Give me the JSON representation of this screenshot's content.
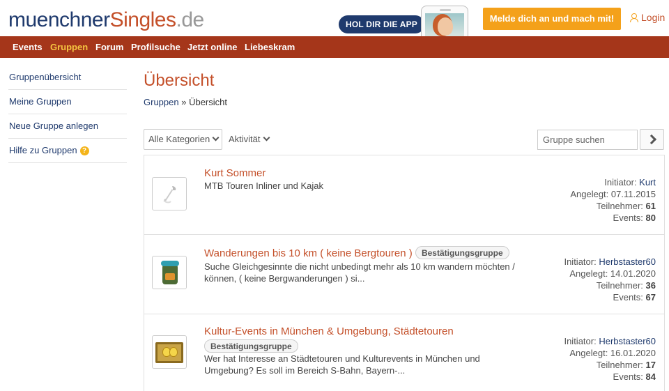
{
  "header": {
    "logo": {
      "part1": "muenchner",
      "part2": "Singles",
      "part3": ".de"
    },
    "app_badge": "HOL DIR DIE APP",
    "cta_label": "Melde dich an und mach mit!",
    "login_label": "Login",
    "colors": {
      "brand_blue": "#1f3a6d",
      "brand_orange": "#c4502a",
      "cta": "#f4a11a",
      "nav_bg": "#a5361a"
    }
  },
  "nav": {
    "items": [
      {
        "label": "Events"
      },
      {
        "label": "Gruppen",
        "active": true
      },
      {
        "label": "Forum"
      },
      {
        "label": "Profilsuche"
      },
      {
        "label": "Jetzt online"
      },
      {
        "label": "Liebeskram"
      }
    ]
  },
  "sidebar": {
    "items": [
      {
        "label": "Gruppenübersicht"
      },
      {
        "label": "Meine Gruppen"
      },
      {
        "label": "Neue Gruppe anlegen"
      },
      {
        "label": "Hilfe zu Gruppen",
        "icon": "help-icon"
      }
    ],
    "help_glyph": "?"
  },
  "main": {
    "title": "Übersicht",
    "breadcrumb": {
      "link": "Gruppen",
      "separator": "»",
      "current": "Übersicht"
    },
    "filters": {
      "category_select": "Alle Kategorien",
      "activity": "Aktivität"
    },
    "search": {
      "placeholder": "Gruppe suchen"
    },
    "groups": [
      {
        "name": "Kurt Sommer",
        "badge": "",
        "description": "MTB Touren Inliner und Kajak",
        "thumb_icon": "wrench-icon",
        "initiator_label": "Initiator:",
        "initiator": "Kurt",
        "created": "Angelegt: 07.11.2015",
        "members_label": "Teilnehmer:",
        "members": "61",
        "events_label": "Events:",
        "events": "80"
      },
      {
        "name": "Wanderungen bis 10 km ( keine Bergtouren )",
        "badge": "Bestätigungsgruppe",
        "description": "Suche Gleichgesinnte die nicht unbedingt mehr als 10 km wandern möchten / können, ( keine Bergwanderungen ) si...",
        "thumb_icon": "backpack-icon",
        "initiator_label": "Initiator:",
        "initiator": "Herbstaster60",
        "created": "Angelegt: 14.01.2020",
        "members_label": "Teilnehmer:",
        "members": "36",
        "events_label": "Events:",
        "events": "67"
      },
      {
        "name": "Kultur-Events in München & Umgebung, Städtetouren",
        "badge": "Bestätigungsgruppe",
        "description": "Wer hat Interesse an Städtetouren und Kulturevents in München und Umgebung? Es soll im Bereich S-Bahn, Bayern-...",
        "thumb_icon": "theater-masks-icon",
        "initiator_label": "Initiator:",
        "initiator": "Herbstaster60",
        "created": "Angelegt: 16.01.2020",
        "members_label": "Teilnehmer:",
        "members": "17",
        "events_label": "Events:",
        "events": "84"
      }
    ]
  }
}
